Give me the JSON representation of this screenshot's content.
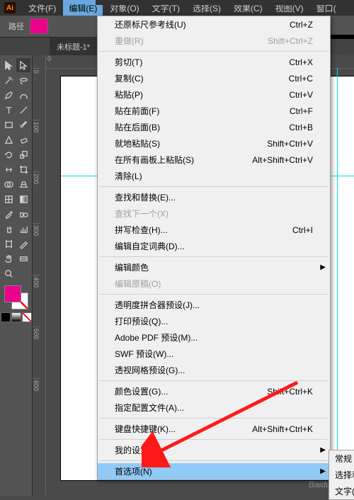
{
  "app": {
    "logo": "Ai"
  },
  "menubar": [
    "文件(F)",
    "编辑(E)",
    "对象(O)",
    "文字(T)",
    "选择(S)",
    "效果(C)",
    "视图(V)",
    "窗口("
  ],
  "options": {
    "path_label": "路径"
  },
  "doc": {
    "tab": "未标题-1*"
  },
  "ruler": {
    "h": [
      "0",
      ""
    ],
    "v": [
      "0",
      "100",
      "200",
      "300",
      "400",
      "500",
      "600"
    ]
  },
  "edit_menu": [
    {
      "t": "item",
      "label": "还原标尺参考线(U)",
      "sc": "Ctrl+Z"
    },
    {
      "t": "item",
      "label": "重做(R)",
      "sc": "Shift+Ctrl+Z",
      "disabled": true
    },
    {
      "t": "sep"
    },
    {
      "t": "item",
      "label": "剪切(T)",
      "sc": "Ctrl+X"
    },
    {
      "t": "item",
      "label": "复制(C)",
      "sc": "Ctrl+C"
    },
    {
      "t": "item",
      "label": "粘贴(P)",
      "sc": "Ctrl+V"
    },
    {
      "t": "item",
      "label": "贴在前面(F)",
      "sc": "Ctrl+F"
    },
    {
      "t": "item",
      "label": "贴在后面(B)",
      "sc": "Ctrl+B"
    },
    {
      "t": "item",
      "label": "就地粘贴(S)",
      "sc": "Shift+Ctrl+V"
    },
    {
      "t": "item",
      "label": "在所有画板上粘贴(S)",
      "sc": "Alt+Shift+Ctrl+V"
    },
    {
      "t": "item",
      "label": "清除(L)"
    },
    {
      "t": "sep"
    },
    {
      "t": "item",
      "label": "查找和替换(E)..."
    },
    {
      "t": "item",
      "label": "查找下一个(X)",
      "disabled": true
    },
    {
      "t": "item",
      "label": "拼写检查(H)...",
      "sc": "Ctrl+I"
    },
    {
      "t": "item",
      "label": "编辑自定词典(D)..."
    },
    {
      "t": "sep"
    },
    {
      "t": "item",
      "label": "编辑颜色",
      "sub": true
    },
    {
      "t": "item",
      "label": "编辑原稿(O)",
      "disabled": true
    },
    {
      "t": "sep"
    },
    {
      "t": "item",
      "label": "透明度拼合器预设(J)..."
    },
    {
      "t": "item",
      "label": "打印预设(Q)..."
    },
    {
      "t": "item",
      "label": "Adobe PDF 预设(M)..."
    },
    {
      "t": "item",
      "label": "SWF 预设(W)..."
    },
    {
      "t": "item",
      "label": "透视网格预设(G)..."
    },
    {
      "t": "sep"
    },
    {
      "t": "item",
      "label": "颜色设置(G)...",
      "sc": "Shift+Ctrl+K"
    },
    {
      "t": "item",
      "label": "指定配置文件(A)..."
    },
    {
      "t": "sep"
    },
    {
      "t": "item",
      "label": "键盘快捷键(K)...",
      "sc": "Alt+Shift+Ctrl+K"
    },
    {
      "t": "sep"
    },
    {
      "t": "item",
      "label": "我的设置",
      "sub": true
    },
    {
      "t": "sep"
    },
    {
      "t": "item",
      "label": "首选项(N)",
      "sub": true,
      "highlight": true
    }
  ],
  "submenu": [
    "常规",
    "选择和",
    "文字("
  ],
  "watermark": "Baidu 经验"
}
